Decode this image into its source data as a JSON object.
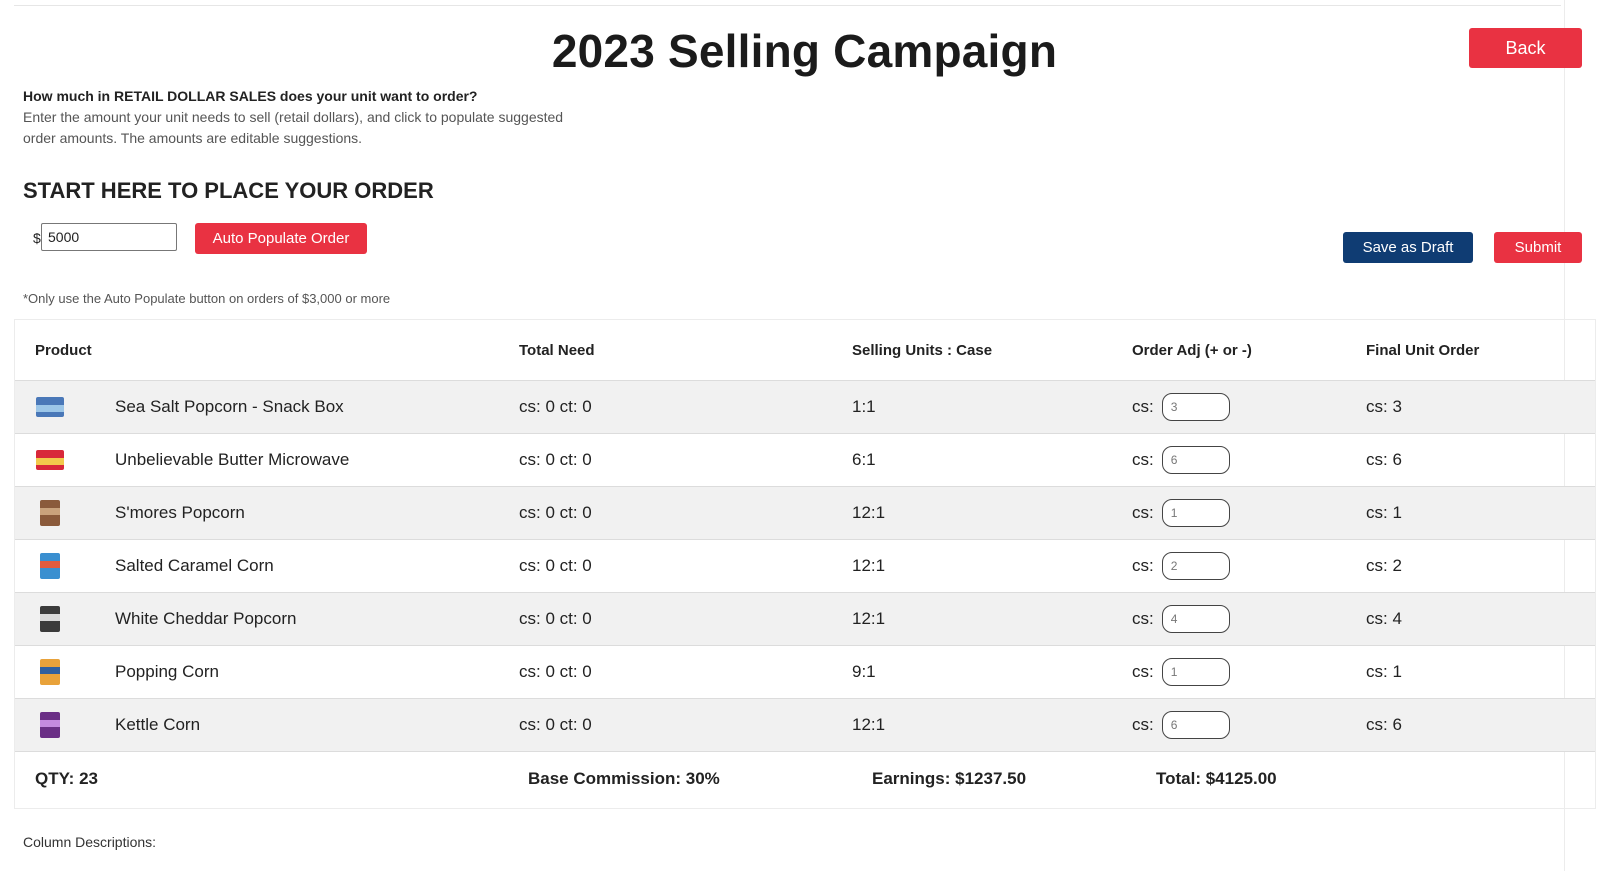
{
  "page": {
    "title": "2023 Selling Campaign",
    "back_label": "Back"
  },
  "intro": {
    "question": "How much in RETAIL DOLLAR SALES does your unit want to order?",
    "description": "Enter the amount your unit needs to sell (retail dollars), and click to populate suggested order amounts. The amounts are editable suggestions."
  },
  "order_start": {
    "heading": "START HERE TO PLACE YOUR ORDER",
    "currency_symbol": "$",
    "amount_value": "5000",
    "auto_populate_label": "Auto Populate Order",
    "save_draft_label": "Save as Draft",
    "submit_label": "Submit",
    "note": "*Only use the Auto Populate button on orders of $3,000 or more"
  },
  "table": {
    "headers": {
      "product": "Product",
      "total_need": "Total Need",
      "selling_units": "Selling Units : Case",
      "order_adj": "Order Adj (+ or -)",
      "final_unit_order": "Final Unit Order"
    },
    "cs_label": "cs:",
    "rows": [
      {
        "icon": "popcorn-snack-box-icon",
        "name": "Sea Salt Popcorn - Snack Box",
        "total_need": "cs: 0 ct: 0",
        "units": "1:1",
        "adj": "3",
        "final": "cs: 3",
        "color": "#4a78b8",
        "band": "#9cc6e8"
      },
      {
        "icon": "butter-microwave-box-icon",
        "name": "Unbelievable Butter Microwave",
        "total_need": "cs: 0 ct: 0",
        "units": "6:1",
        "adj": "6",
        "final": "cs: 6",
        "color": "#d8283a",
        "band": "#f2c94c"
      },
      {
        "icon": "smores-bag-icon",
        "name": "S'mores Popcorn",
        "total_need": "cs: 0 ct: 0",
        "units": "12:1",
        "adj": "1",
        "final": "cs: 1",
        "color": "#8a5a3b",
        "band": "#c9a27c"
      },
      {
        "icon": "salted-caramel-bag-icon",
        "name": "Salted Caramel Corn",
        "total_need": "cs: 0 ct: 0",
        "units": "12:1",
        "adj": "2",
        "final": "cs: 2",
        "color": "#3a8fd0",
        "band": "#e25b3f"
      },
      {
        "icon": "white-cheddar-bag-icon",
        "name": "White Cheddar Popcorn",
        "total_need": "cs: 0 ct: 0",
        "units": "12:1",
        "adj": "4",
        "final": "cs: 4",
        "color": "#3b3b3b",
        "band": "#d9d9d9"
      },
      {
        "icon": "popping-corn-jar-icon",
        "name": "Popping Corn",
        "total_need": "cs: 0 ct: 0",
        "units": "9:1",
        "adj": "1",
        "final": "cs: 1",
        "color": "#e8a23a",
        "band": "#2f5f9e"
      },
      {
        "icon": "kettle-corn-bag-icon",
        "name": "Kettle Corn",
        "total_need": "cs: 0 ct: 0",
        "units": "12:1",
        "adj": "6",
        "final": "cs: 6",
        "color": "#6b2f86",
        "band": "#c58adf"
      }
    ],
    "footer": {
      "qty": "QTY: 23",
      "commission": "Base Commission: 30%",
      "earnings": "Earnings: $1237.50",
      "total": "Total: $4125.00"
    }
  },
  "column_descriptions_label": "Column Descriptions:"
}
